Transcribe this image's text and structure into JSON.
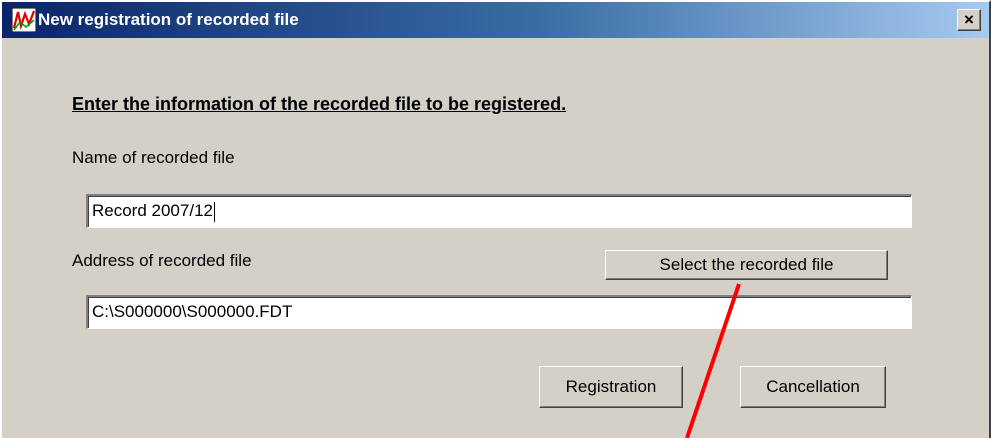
{
  "window": {
    "title": "New registration of recorded file",
    "close_label": "×"
  },
  "form": {
    "heading": "Enter the information of the recorded file to be registered.",
    "name_label": "Name of recorded file",
    "name_value": "Record 2007/12",
    "address_label": "Address of recorded file",
    "address_value": "C:\\S000000\\S000000.FDT",
    "select_button": "Select the recorded file",
    "registration_button": "Registration",
    "cancellation_button": "Cancellation"
  },
  "colors": {
    "dialog_bg": "#d4d0c8",
    "titlebar_start": "#0a246a",
    "titlebar_end": "#a6caf0",
    "annotation_arrow": "#ff0000"
  }
}
